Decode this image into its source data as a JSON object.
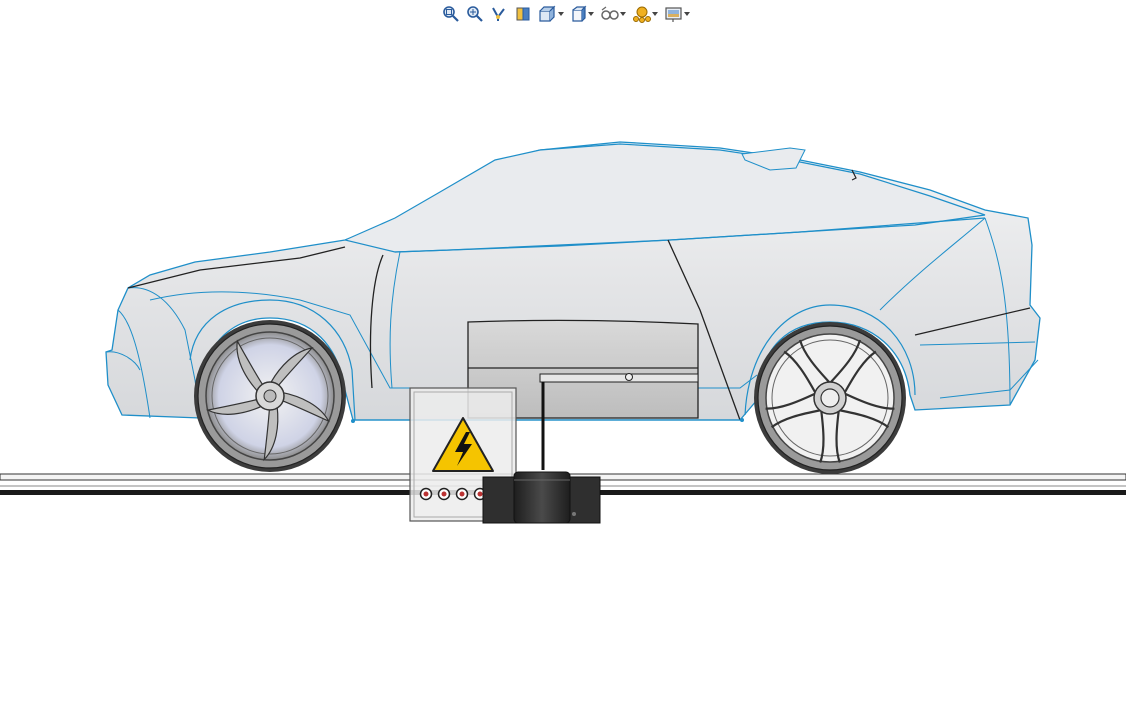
{
  "app": {
    "kind": "3D CAD graphics area"
  },
  "toolbar": {
    "items": [
      {
        "icon": "zoom-to-fit-icon",
        "dropdown": false
      },
      {
        "icon": "zoom-to-area-icon",
        "dropdown": false
      },
      {
        "icon": "previous-view-icon",
        "dropdown": false
      },
      {
        "icon": "section-view-icon",
        "dropdown": false
      },
      {
        "icon": "view-orientation-icon",
        "dropdown": true
      },
      {
        "icon": "display-style-icon",
        "dropdown": true
      },
      {
        "icon": "hide-show-items-icon",
        "dropdown": true
      },
      {
        "icon": "edit-appearance-icon",
        "dropdown": true
      },
      {
        "icon": "apply-scene-icon",
        "dropdown": true
      }
    ]
  },
  "model": {
    "parts": [
      "car-body",
      "front-wheel",
      "rear-wheel",
      "battery-pack",
      "charging-cabinet",
      "charging-connector",
      "ground-rail",
      "high-voltage-warning-sign"
    ]
  },
  "colors": {
    "edge_highlight": "#1f8fc9",
    "body_fill": "#e8e9eb",
    "battery_fill": "#c9c9c9",
    "warning_yellow": "#f5c400",
    "connector_dark": "#2b2b2b",
    "rail_dark": "#1a1a1a"
  }
}
